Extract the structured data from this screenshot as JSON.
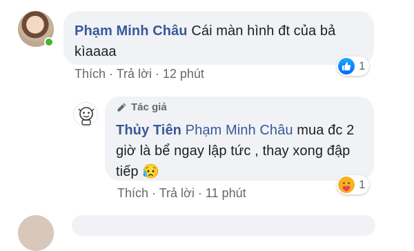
{
  "comment1": {
    "author": "Phạm Minh Châu",
    "text": "Cái màn hình đt của bả kìaaaa",
    "like_label": "Thích",
    "reply_label": "Trả lời",
    "time": "12 phút",
    "reaction_count": "1",
    "reaction_icon": "like-icon",
    "online_color": "#42b72a"
  },
  "reply1": {
    "badge": "Tác giả",
    "author": "Thủy Tiên",
    "tag": "Phạm Minh Châu",
    "text": "mua đc 2 giờ là bể ngay lập tức , thay xong đập tiếp",
    "emoji": "😥",
    "like_label": "Thích",
    "reply_label": "Trả lời",
    "time": "11 phút",
    "reaction_count": "1",
    "reaction_icon": "care-icon"
  },
  "colors": {
    "name": "#385898",
    "meta": "#65676b",
    "bubble": "#f0f2f5",
    "like": "#0866ff"
  }
}
